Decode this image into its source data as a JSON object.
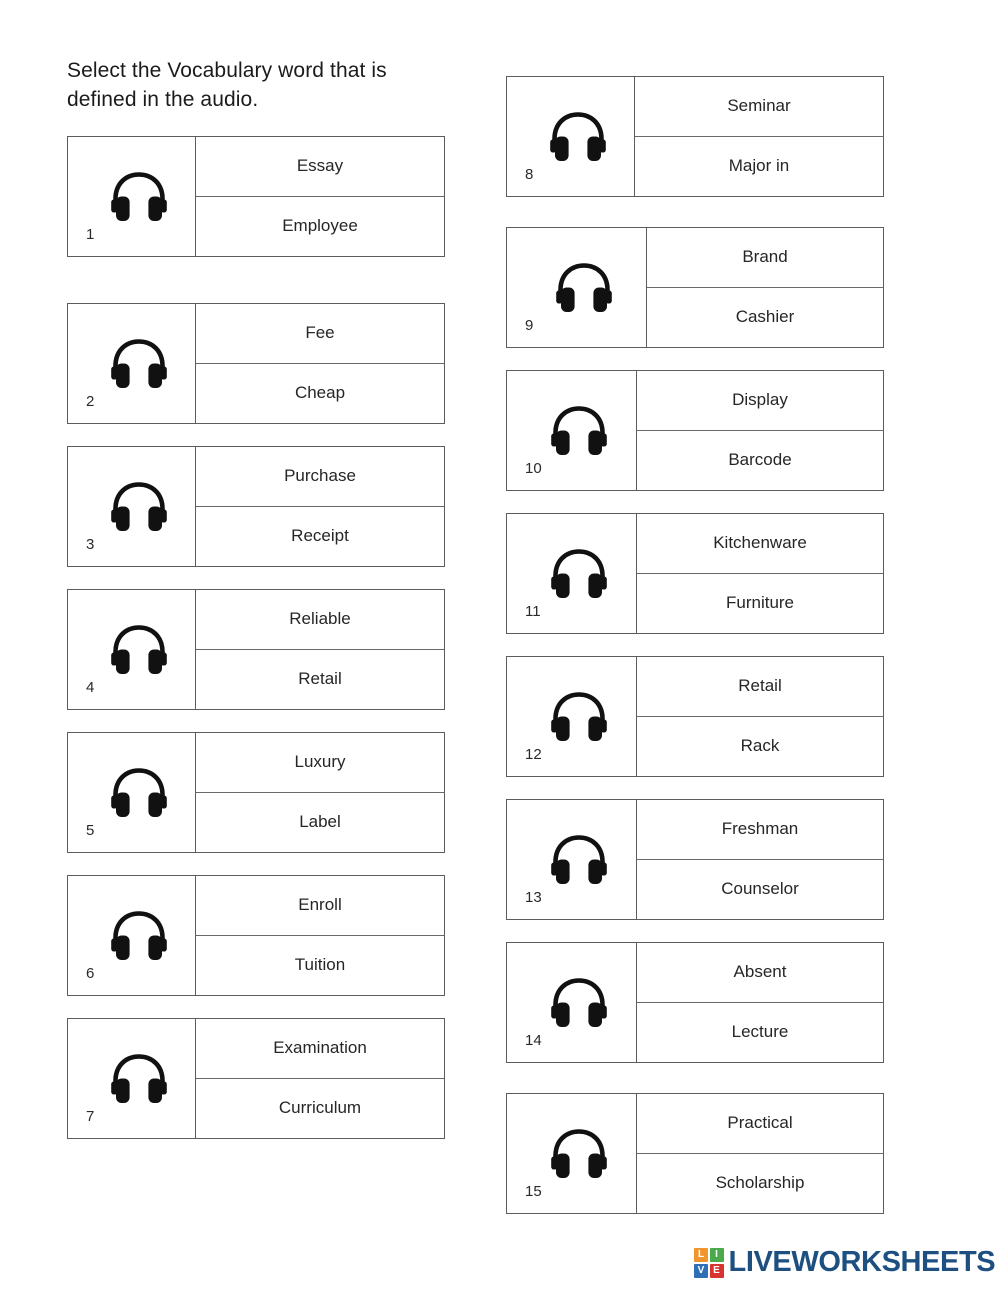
{
  "worksheet": {
    "instruction": "Select the Vocabulary word that is defined in the audio.",
    "icon_name": "headphones-icon",
    "text_color": "#262626",
    "border_color": "#5c5c5c"
  },
  "left_column": [
    {
      "number": "1",
      "options": [
        "Essay",
        "Employee"
      ]
    },
    {
      "number": "2",
      "options": [
        "Fee",
        "Cheap"
      ]
    },
    {
      "number": "3",
      "options": [
        "Purchase",
        "Receipt"
      ]
    },
    {
      "number": "4",
      "options": [
        "Reliable",
        "Retail"
      ]
    },
    {
      "number": "5",
      "options": [
        "Luxury",
        "Label"
      ]
    },
    {
      "number": "6",
      "options": [
        "Enroll",
        "Tuition"
      ]
    },
    {
      "number": "7",
      "options": [
        "Examination",
        "Curriculum"
      ]
    }
  ],
  "right_column": [
    {
      "number": "8",
      "options": [
        "Seminar",
        "Major in"
      ]
    },
    {
      "number": "9",
      "options": [
        "Brand",
        "Cashier"
      ]
    },
    {
      "number": "10",
      "options": [
        "Display",
        "Barcode"
      ]
    },
    {
      "number": "11",
      "options": [
        "Kitchenware",
        "Furniture"
      ]
    },
    {
      "number": "12",
      "options": [
        "Retail",
        "Rack"
      ]
    },
    {
      "number": "13",
      "options": [
        "Freshman",
        "Counselor"
      ]
    },
    {
      "number": "14",
      "options": [
        "Absent",
        "Lecture"
      ]
    },
    {
      "number": "15",
      "options": [
        "Practical",
        "Scholarship"
      ]
    }
  ],
  "footer": {
    "brand_name": "LIVEWORKSHEETS",
    "brand_color": "#1d4f81",
    "logo_tiles": [
      {
        "letter": "L",
        "color": "#f0962d"
      },
      {
        "letter": "I",
        "color": "#4aa94a"
      },
      {
        "letter": "V",
        "color": "#2f6fb5"
      },
      {
        "letter": "E",
        "color": "#d8332f"
      }
    ]
  }
}
